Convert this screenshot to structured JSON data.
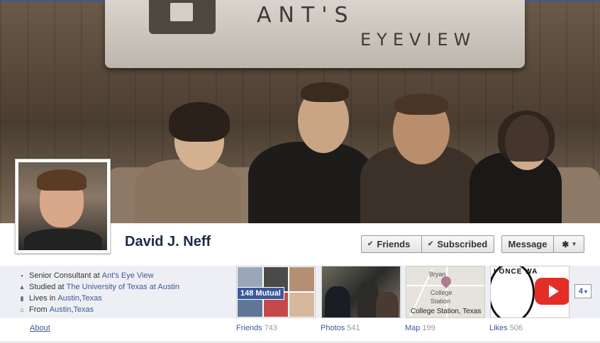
{
  "cover": {
    "sign_text_line1": "ANT'S",
    "sign_text_line2": "EYEVIEW"
  },
  "profile": {
    "name": "David J. Neff"
  },
  "actions": {
    "friends_label": "Friends",
    "subscribed_label": "Subscribed",
    "message_label": "Message",
    "check_glyph": "✔",
    "gear_glyph": "✱",
    "caret_glyph": "▾"
  },
  "info": {
    "work_prefix": "Senior Consultant at ",
    "work_link": "Ant's Eye View",
    "school_prefix": "Studied at ",
    "school_link": "The University of Texas at Austin",
    "lives_prefix": "Lives in ",
    "lives_city": "Austin",
    "lives_sep": ", ",
    "lives_state": "Texas",
    "from_prefix": "From ",
    "from_city": "Austin",
    "from_sep": ", ",
    "from_state": "Texas"
  },
  "about_link": "About",
  "tiles": {
    "friends": {
      "label": "Friends",
      "count": "743",
      "mutual": "148 Mutual"
    },
    "photos": {
      "label": "Photos",
      "count": "541"
    },
    "map": {
      "label": "Map",
      "count": "199",
      "caption": "College Station, Texas",
      "place1": "Bryan",
      "place2": "College",
      "place3": "Station"
    },
    "likes": {
      "label": "Likes",
      "count": "506",
      "badge_text": "I ONCE WA"
    },
    "more": {
      "count": "4"
    }
  },
  "colors": {
    "fb_blue": "#3b5998",
    "name_color": "#1c2a47",
    "info_bg": "#edeff4"
  },
  "icons": [
    "briefcase-icon",
    "graduation-cap-icon",
    "building-icon",
    "house-icon",
    "gear-icon",
    "check-icon",
    "chevron-down-icon"
  ]
}
